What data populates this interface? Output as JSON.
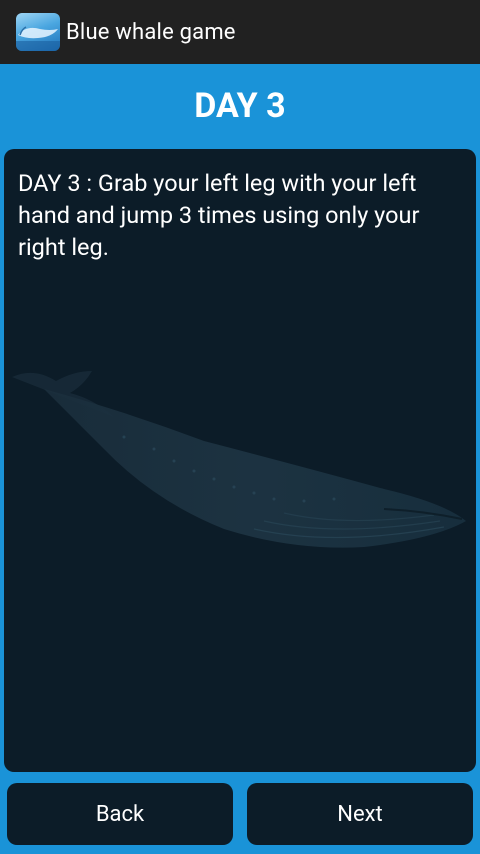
{
  "app_bar": {
    "title": "Blue whale game",
    "icon": "blue-whale-app-icon"
  },
  "day": {
    "heading": "DAY 3",
    "challenge_text": "DAY 3 : Grab your left leg with your left hand and jump 3 times using only your right leg.",
    "background_image": "whale-silhouette"
  },
  "navigation": {
    "back_label": "Back",
    "next_label": "Next"
  },
  "colors": {
    "page_background": "#1a93d8",
    "app_bar": "#212121",
    "card_background": "#0c1c28",
    "text": "#ffffff"
  }
}
